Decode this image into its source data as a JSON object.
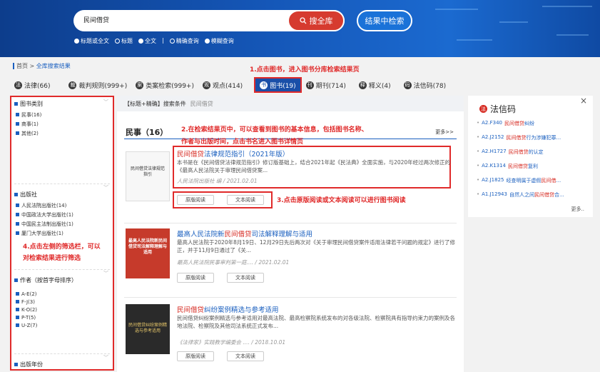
{
  "search": {
    "query": "民间借贷",
    "search_all_label": "搜全库",
    "search_within_label": "结果中检索",
    "options": [
      "标题或全文",
      "标题",
      "全文",
      "精确查询",
      "模糊查询"
    ],
    "divider": "|"
  },
  "breadcrumb": {
    "home": "首页",
    "sep": ">",
    "current": "全库搜索结果"
  },
  "tabs": [
    {
      "label": "法律(66)",
      "icon": "law-icon"
    },
    {
      "label": "裁判规则(999+)",
      "icon": "ruling-icon"
    },
    {
      "label": "类案检索(999+)",
      "icon": "case-icon"
    },
    {
      "label": "观点(414)",
      "icon": "opinion-icon"
    },
    {
      "label": "图书(19)",
      "icon": "book-icon"
    },
    {
      "label": "期刊(714)",
      "icon": "journal-icon"
    },
    {
      "label": "释义(4)",
      "icon": "interpretation-icon"
    },
    {
      "label": "法信码(78)",
      "icon": "code-icon"
    }
  ],
  "sidebar": {
    "sections": [
      {
        "title": "图书类别",
        "items": [
          "民事(16)",
          "商事(1)",
          "其他(2)"
        ]
      },
      {
        "title": "出版社",
        "items": [
          "人民法院出版社(14)",
          "中国政法大学出版社(1)",
          "中国民主法制出版社(1)",
          "厦门大学出版社(1)"
        ]
      },
      {
        "title": "作者（按首字母排序）",
        "items": [
          "A-E(2)",
          "F-J(3)",
          "K-O(2)",
          "P-T(5)",
          "U-Z(7)"
        ]
      },
      {
        "title": "出版年份",
        "items": []
      }
    ]
  },
  "main": {
    "condition_label": "【标题+精确】搜索条件",
    "condition_query": "民间借贷",
    "section_title": "民事（16）",
    "more_label": "更多>>",
    "books": [
      {
        "title_hl": "民间借贷",
        "title_rest": "法律规范指引（2021年版）",
        "desc": "本书是在《民间借贷法律规范指引》修订版基础上，结合2021年起《民法典》全面实施，与2020年经过两次修正的《最高人民法院关于审理民间借贷案...",
        "meta": "人民法院出版社 编 / 2021.02.01",
        "cover_text": "民间借贷法律规范指引",
        "btn_original": "原版阅读",
        "btn_text": "文本阅读"
      },
      {
        "title_pre": "最高人民法院新",
        "title_hl": "民间借贷",
        "title_rest": "司法解释理解与适用",
        "desc": "最高人民法院于2020年8月19日、12月29日先后两次对《关于审理民间借贷案件适用法律若干问题的规定》进行了修正，并于11月9日通过了《关...",
        "meta": "最高人民法院民事审判第一庭.... / 2021.02.01",
        "cover_text": "最高人民法院新民间借贷司法解释理解与适用",
        "btn_original": "原版阅读",
        "btn_text": "文本阅读"
      },
      {
        "title_hl": "民间借贷",
        "title_rest": "纠纷案例精选与参考适用",
        "desc": "民间借贷纠纷案例精选与参考适用对最高法院、最高检察院系统发布的对各级法院、检察院具有指导约束力的案例及各地法院、检察院及其他司法系统正式发布...",
        "meta": "《法律家》实践教学编委会 .... / 2018.10.01",
        "cover_text": "民间借贷纠纷案例精选与参考适用",
        "btn_original": "原版阅读",
        "btn_text": "文本阅读"
      }
    ]
  },
  "annotations": {
    "a1": "1.点击图书，进入图书分库检索结果页",
    "a2_line1": "2.在检索结果页中，可以查看到图书的基本信息，包括图书名称、",
    "a2_line2": "作者与出版时间，点击书名进入图书详情页",
    "a3": "3.点击原版阅读或文本阅读可以进行图书阅读",
    "a4_line1": "4.点击左侧的筛选栏，可以",
    "a4_line2": "对检索结果进行筛选"
  },
  "right_panel": {
    "title": "法信码",
    "close": "×",
    "items": [
      {
        "code": "A2.F340",
        "hl": "民间借贷",
        "rest": "纠纷"
      },
      {
        "code": "A2.J2152",
        "hl": "民间借贷",
        "rest": "行为涉嫌犯罪..."
      },
      {
        "code": "A2.H1727",
        "hl": "民间借贷",
        "rest": "的认定"
      },
      {
        "code": "A2.K1314",
        "hl": "民间借贷",
        "rest": "复利"
      },
      {
        "code": "A2.J1825",
        "pre": "经查明属于虚假",
        "hl": "民间借",
        "rest": "..."
      },
      {
        "code": "A1.J12943",
        "pre": "自然人之间",
        "hl": "民间借贷",
        "rest": "合..."
      }
    ],
    "more": "更多.."
  },
  "colors": {
    "accent": "#1a5fbf",
    "highlight": "#d6281f",
    "annotation": "#e02a2a"
  }
}
